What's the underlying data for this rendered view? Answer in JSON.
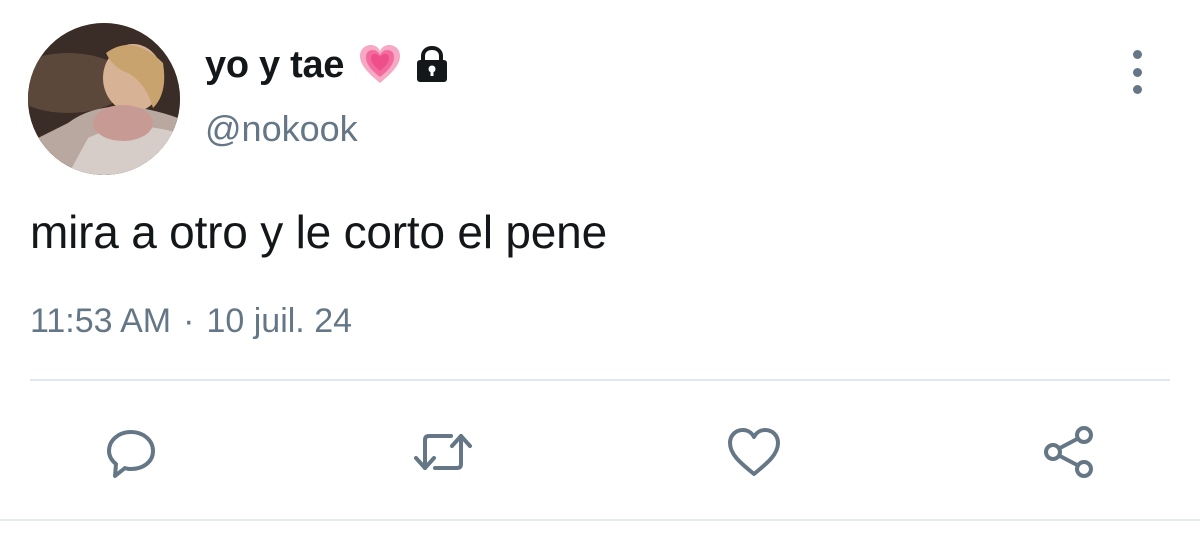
{
  "tweet": {
    "display_name": "yo y tae",
    "handle": "@nokook",
    "text": "mira a otro y le corto el pene",
    "time": "11:53 AM",
    "separator": "·",
    "date": "10 juil. 24"
  },
  "icons": {
    "name_emoji": "growing-heart-icon",
    "protected": "lock-icon",
    "more": "more-vertical-icon",
    "reply": "reply-icon",
    "retweet": "retweet-icon",
    "like": "heart-outline-icon",
    "share": "share-icon"
  },
  "colors": {
    "text": "#14171a",
    "secondary": "#657786",
    "divider": "#e1e8ed",
    "heart_emoji": "#f26b9c"
  }
}
